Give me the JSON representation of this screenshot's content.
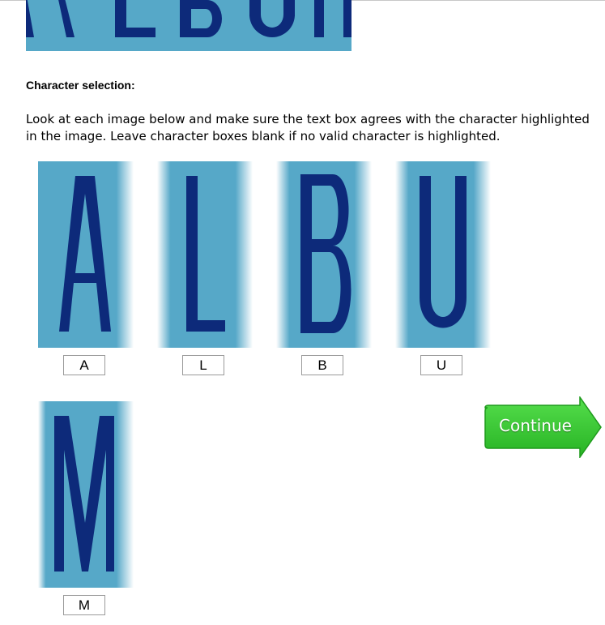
{
  "captcha": {
    "word_image_letters": "ALBUM",
    "tile_color": "#56a8c8",
    "glyph_color": "#0d2a7a"
  },
  "section": {
    "heading": "Character selection:",
    "instructions": "Look at each image below and make sure the text box agrees with the character highlighted in the image. Leave character boxes blank if no valid character is highlighted."
  },
  "characters": [
    {
      "image_letter": "A",
      "value": "A"
    },
    {
      "image_letter": "L",
      "value": "L"
    },
    {
      "image_letter": "B",
      "value": "B"
    },
    {
      "image_letter": "U",
      "value": "U"
    },
    {
      "image_letter": "M",
      "value": "M"
    }
  ],
  "continue_button": {
    "label": "Continue",
    "color": "#3fcf3a"
  }
}
